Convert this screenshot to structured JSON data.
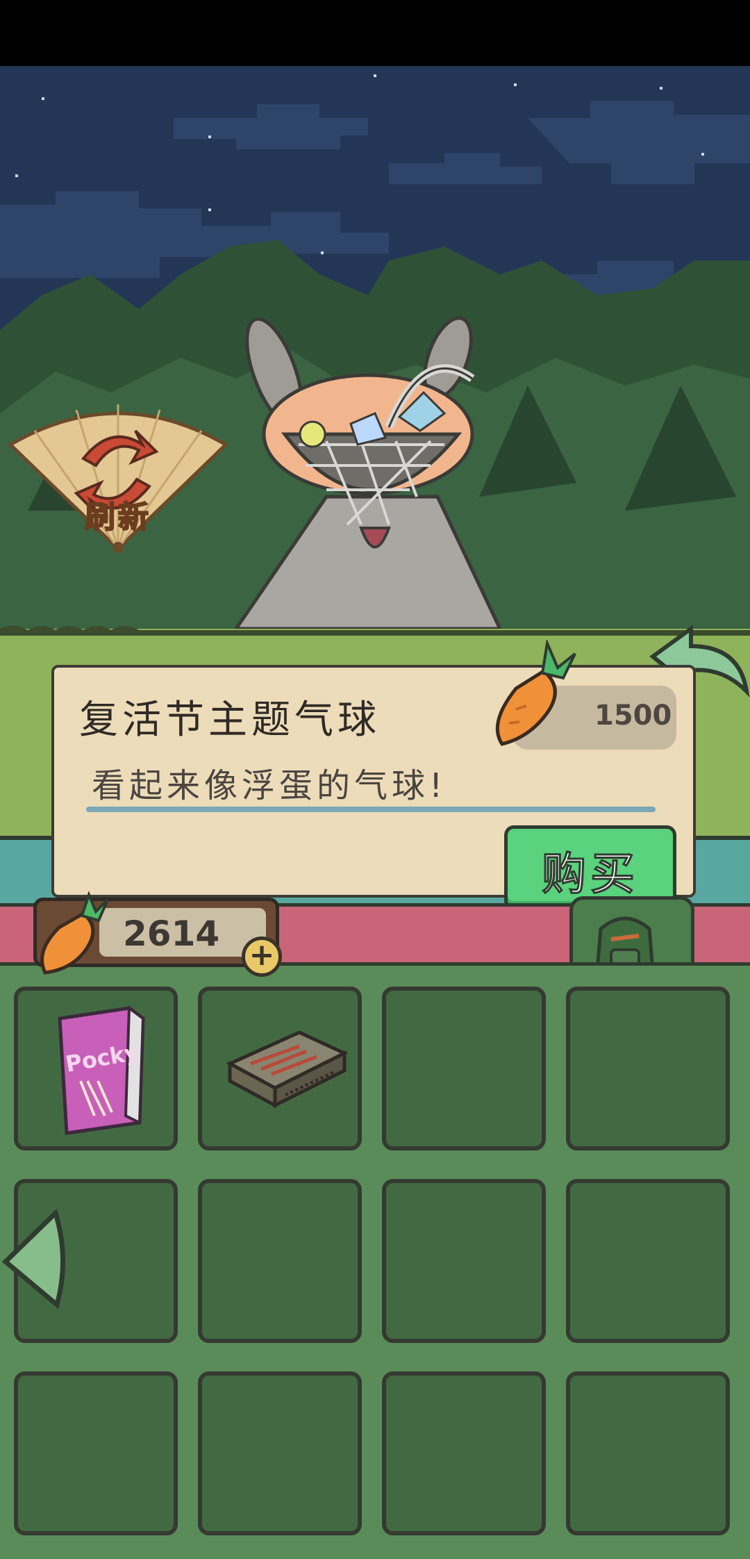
{
  "refresh": {
    "label": "刷新"
  },
  "item": {
    "name": "复活节主题气球",
    "price": "1500",
    "description": "看起来像浮蛋的气球!"
  },
  "buy_button": {
    "label": "购买"
  },
  "wallet": {
    "carrots": "2614"
  },
  "inventory": {
    "slots": [
      {
        "item": "pocky-box",
        "label": "Pocky"
      },
      {
        "item": "matchbox",
        "label": ""
      },
      {
        "item": "",
        "label": ""
      },
      {
        "item": "",
        "label": ""
      },
      {
        "item": "",
        "label": ""
      },
      {
        "item": "",
        "label": ""
      },
      {
        "item": "",
        "label": ""
      },
      {
        "item": "",
        "label": ""
      },
      {
        "item": "",
        "label": ""
      },
      {
        "item": "",
        "label": ""
      },
      {
        "item": "",
        "label": ""
      },
      {
        "item": "",
        "label": ""
      }
    ]
  },
  "icons": [
    "refresh-fan-icon",
    "carrot-icon",
    "back-arrow-icon",
    "plus-icon",
    "backpack-icon",
    "left-arrow-icon",
    "pocky-box-icon",
    "matchbox-icon"
  ],
  "colors": {
    "night_sky": "#243656",
    "grass": "#8fb35a",
    "panel": "#ecdcb9",
    "buy": "#5ad27e",
    "pink_strip": "#c96479",
    "inventory": "#5a8c5a",
    "slot": "#426a42"
  }
}
